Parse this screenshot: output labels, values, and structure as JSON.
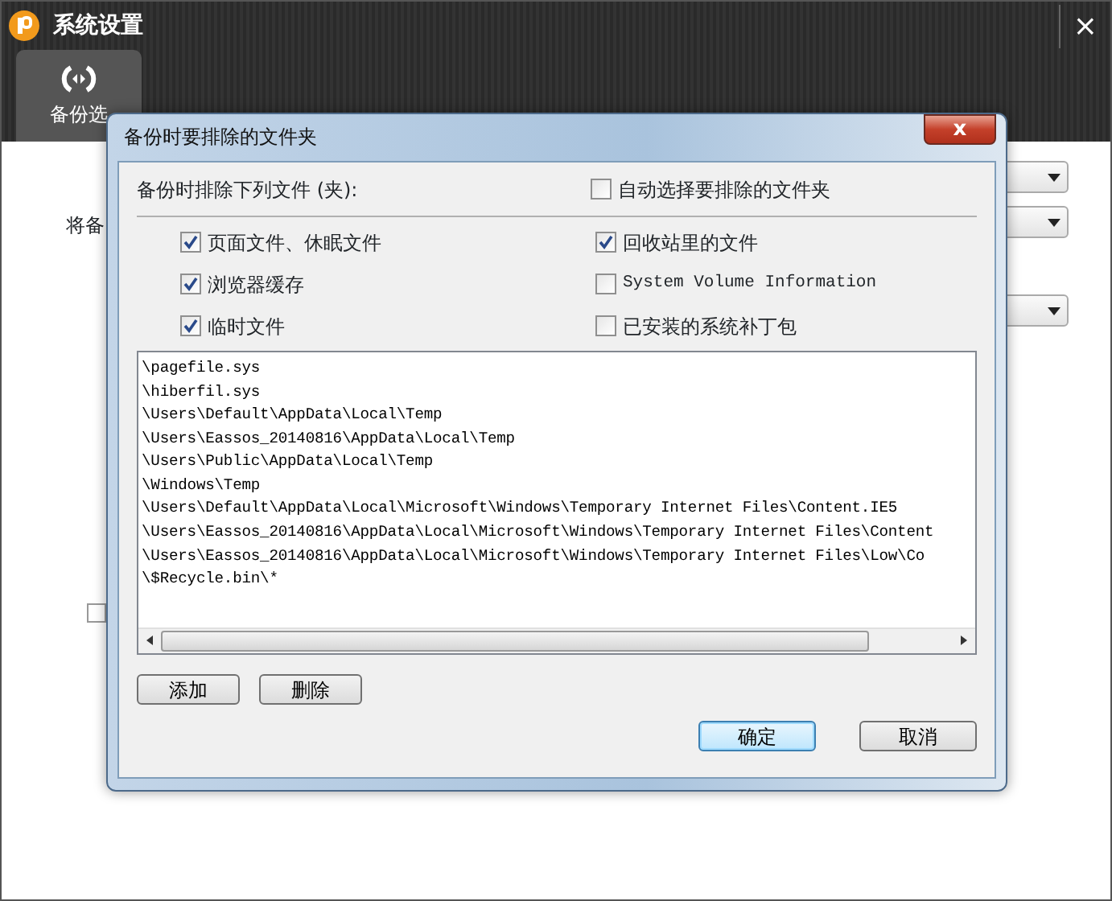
{
  "window": {
    "title": "系统设置",
    "close": "×"
  },
  "sidebar": {
    "tabs": [
      {
        "label": "备份选",
        "selected": true
      }
    ]
  },
  "background": {
    "label": "将备",
    "checkbox": {
      "checked": false
    }
  },
  "dialog": {
    "title": "备份时要排除的文件夹",
    "close": "x",
    "heading": "备份时排除下列文件 (夹):",
    "auto_select": {
      "label": "自动选择要排除的文件夹",
      "checked": false
    },
    "options": [
      {
        "label": "页面文件、休眠文件",
        "checked": true,
        "kind": "cjk"
      },
      {
        "label": "回收站里的文件",
        "checked": true,
        "kind": "cjk"
      },
      {
        "label": "浏览器缓存",
        "checked": true,
        "kind": "cjk"
      },
      {
        "label": "System Volume Information",
        "checked": false,
        "kind": "mono"
      },
      {
        "label": "临时文件",
        "checked": true,
        "kind": "cjk"
      },
      {
        "label": "已安装的系统补丁包",
        "checked": false,
        "kind": "cjk"
      }
    ],
    "paths": [
      "\\pagefile.sys",
      "\\hiberfil.sys",
      "\\Users\\Default\\AppData\\Local\\Temp",
      "\\Users\\Eassos_20140816\\AppData\\Local\\Temp",
      "\\Users\\Public\\AppData\\Local\\Temp",
      "\\Windows\\Temp",
      "\\Users\\Default\\AppData\\Local\\Microsoft\\Windows\\Temporary Internet Files\\Content.IE5",
      "\\Users\\Eassos_20140816\\AppData\\Local\\Microsoft\\Windows\\Temporary Internet Files\\Content",
      "\\Users\\Eassos_20140816\\AppData\\Local\\Microsoft\\Windows\\Temporary Internet Files\\Low\\Co",
      "\\$Recycle.bin\\*"
    ],
    "list_buttons": [
      "添加",
      "删除"
    ],
    "buttons": [
      {
        "label": "确定",
        "default": true
      },
      {
        "label": "取消",
        "default": false
      }
    ]
  }
}
